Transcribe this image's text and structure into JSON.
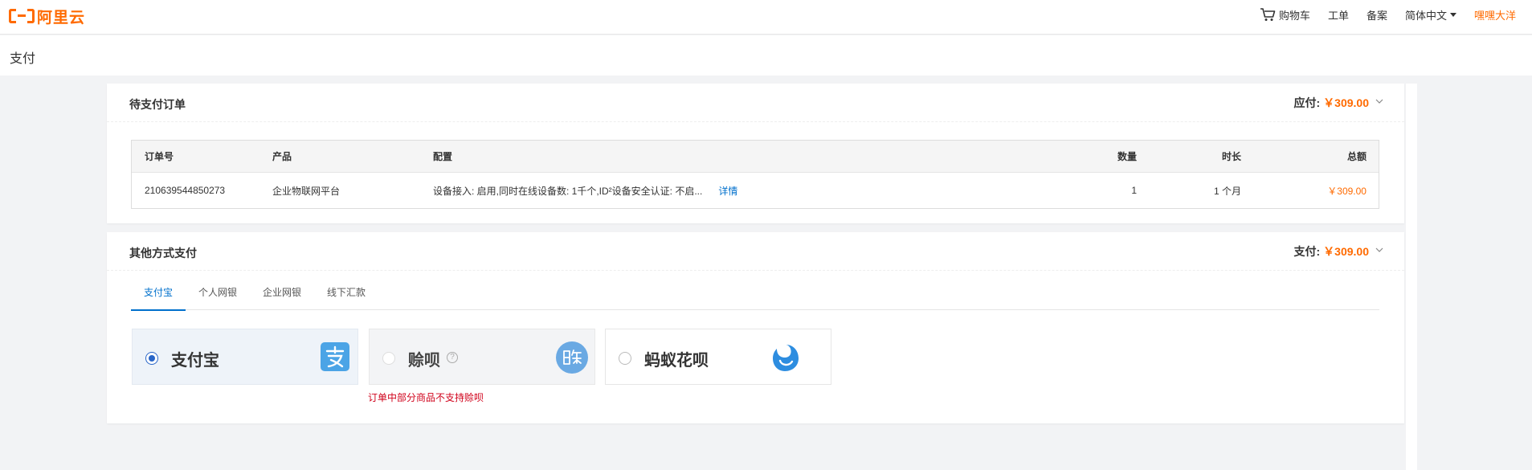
{
  "brand": {
    "logo_text": "阿里云"
  },
  "nav": {
    "cart_label": "购物车",
    "ticket_label": "工单",
    "icp_label": "备案",
    "language_label": "简体中文",
    "user_name": "嘿嘿大洋"
  },
  "page": {
    "title": "支付"
  },
  "pending_order": {
    "title": "待支付订单",
    "amount_label": "应付:",
    "amount_value": "￥309.00",
    "columns": [
      "订单号",
      "产品",
      "配置",
      "数量",
      "时长",
      "总额"
    ],
    "rows": [
      {
        "order_id": "210639544850273",
        "product": "企业物联网平台",
        "config": "设备接入: 启用,同时在线设备数: 1千个,ID²设备安全认证: 不启...",
        "detail_link": "详情",
        "quantity": "1",
        "duration": "1 个月",
        "total": "￥309.00"
      }
    ]
  },
  "other_payment": {
    "title": "其他方式支付",
    "amount_label": "支付:",
    "amount_value": "￥309.00",
    "tabs": [
      {
        "label": "支付宝",
        "active": true
      },
      {
        "label": "个人网银",
        "active": false
      },
      {
        "label": "企业网银",
        "active": false
      },
      {
        "label": "线下汇款",
        "active": false
      }
    ],
    "methods": [
      {
        "name": "支付宝",
        "selected": true,
        "disabled": false,
        "icon": "alipay-icon"
      },
      {
        "name": "赊呗",
        "selected": false,
        "disabled": true,
        "icon": "shebei-icon"
      },
      {
        "name": "蚂蚁花呗",
        "selected": false,
        "disabled": false,
        "icon": "huabei-icon"
      }
    ],
    "warning": "订单中部分商品不支持赊呗"
  },
  "colors": {
    "accent": "#ff6a00",
    "link": "#0070cc",
    "error": "#d0021b",
    "selected_bg": "#eef3f9"
  }
}
